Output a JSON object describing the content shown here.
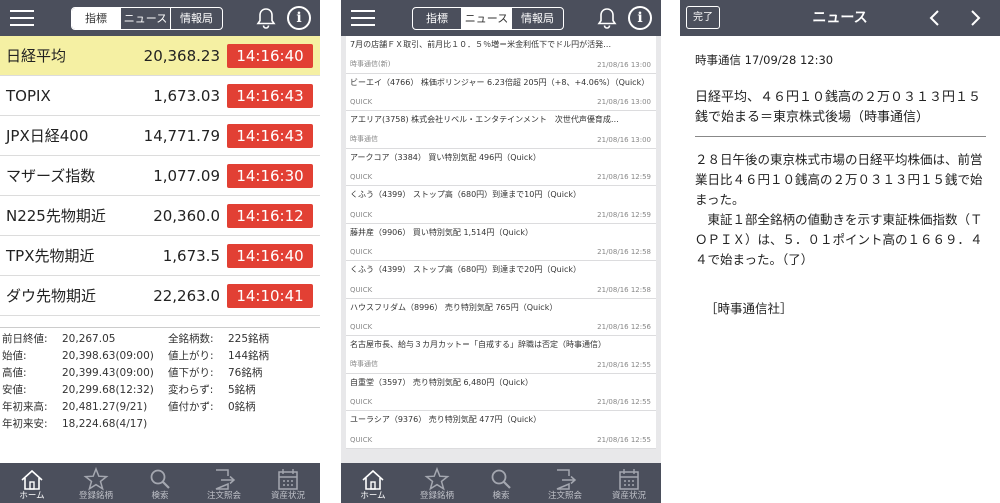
{
  "header": {
    "tabs": [
      "指標",
      "ニュース",
      "情報局"
    ]
  },
  "indices": [
    {
      "name": "日経平均",
      "value": "20,368.23",
      "time": "14:16:40",
      "highlight": true
    },
    {
      "name": "TOPIX",
      "value": "1,673.03",
      "time": "14:16:43"
    },
    {
      "name": "JPX日経400",
      "value": "14,771.79",
      "time": "14:16:43"
    },
    {
      "name": "マザーズ指数",
      "value": "1,077.09",
      "time": "14:16:30"
    },
    {
      "name": "N225先物期近",
      "value": "20,360.0",
      "time": "14:16:12"
    },
    {
      "name": "TPX先物期近",
      "value": "1,673.5",
      "time": "14:16:40"
    },
    {
      "name": "ダウ先物期近",
      "value": "22,263.0",
      "time": "14:10:41"
    }
  ],
  "summary": {
    "left": [
      {
        "label": "前日終値:",
        "value": "20,267.05"
      },
      {
        "label": "始値:",
        "value": "20,398.63(09:00)"
      },
      {
        "label": "高値:",
        "value": "20,399.43(09:00)"
      },
      {
        "label": "安値:",
        "value": "20,299.68(12:32)"
      },
      {
        "label": "年初来高:",
        "value": "20,481.27(9/21)"
      },
      {
        "label": "年初来安:",
        "value": "18,224.68(4/17)"
      }
    ],
    "right": [
      {
        "label": "全銘柄数:",
        "value": "225銘柄"
      },
      {
        "label": "値上がり:",
        "value": "144銘柄"
      },
      {
        "label": "値下がり:",
        "value": "76銘柄"
      },
      {
        "label": "変わらず:",
        "value": "5銘柄"
      },
      {
        "label": "値付かず:",
        "value": "0銘柄"
      }
    ]
  },
  "pager": {
    "total": 2,
    "current": 1
  },
  "tabbar": [
    {
      "label": "ホーム",
      "icon": "home-icon"
    },
    {
      "label": "登録銘柄",
      "icon": "star-icon"
    },
    {
      "label": "検索",
      "icon": "search-icon"
    },
    {
      "label": "注文照会",
      "icon": "order-icon"
    },
    {
      "label": "資産状況",
      "icon": "calendar-icon"
    }
  ],
  "news": [
    {
      "title": "7月の店舗ＦＸ取引、前月比１０．５％増＝米金利低下でドル円が活発…",
      "source": "時事通信(新)",
      "time": "21/08/16 13:00"
    },
    {
      "title": "ビーエイ（4766） 株価ボリンジャー 6.23倍超 205円（+8、+4.06%）（Quick）",
      "source": "QUICK",
      "time": "21/08/16 13:00"
    },
    {
      "title": "アエリア(3758) 株式会社リベル・エンタテインメント　次世代声優育成…",
      "source": "時事通信",
      "time": "21/08/16 13:00"
    },
    {
      "title": "アークコア（3384） 買い特別気配 496円（Quick）",
      "source": "QUICK",
      "time": "21/08/16 12:59"
    },
    {
      "title": "くふう（4399） ストップ高（680円）到達まで10円（Quick）",
      "source": "QUICK",
      "time": "21/08/16 12:59"
    },
    {
      "title": "藤井産（9906） 買い特別気配 1,514円（Quick）",
      "source": "QUICK",
      "time": "21/08/16 12:58"
    },
    {
      "title": "くふう（4399） ストップ高（680円）到達まで20円（Quick）",
      "source": "QUICK",
      "time": "21/08/16 12:58"
    },
    {
      "title": "ハウスフリダム（8996） 売り特別気配 765円（Quick）",
      "source": "QUICK",
      "time": "21/08/16 12:56"
    },
    {
      "title": "名古屋市長、給与３カ月カット＝「自戒する」辞職は否定（時事通信）",
      "source": "時事通信",
      "time": "21/08/16 12:55"
    },
    {
      "title": "自重堂（3597） 売り特別気配 6,480円（Quick）",
      "source": "QUICK",
      "time": "21/08/16 12:55"
    },
    {
      "title": "ユーラシア（9376） 売り特別気配 477円（Quick）",
      "source": "QUICK",
      "time": "21/08/16 12:55"
    }
  ],
  "article": {
    "done_label": "完了",
    "title": "ニュース",
    "meta": "時事通信 17/09/28 12:30",
    "headline": "日経平均、４６円１０銭高の２万０３１３円１５銭で始まる＝東京株式後場（時事通信）",
    "body": "２８日午後の東京株式市場の日経平均株価は、前営業日比４６円１０銭高の２万０３１３円１５銭で始まった。\n　東証１部全銘柄の値動きを示す東証株価指数（ＴＯＰＩＸ）は、５．０１ポイント高の１６６９．４４で始まった。（了）",
    "credit": "［時事通信社］"
  },
  "colors": {
    "header_bg": "#4b4f5c",
    "time_badge": "#e24034",
    "highlight_row": "#f5f0a3"
  }
}
